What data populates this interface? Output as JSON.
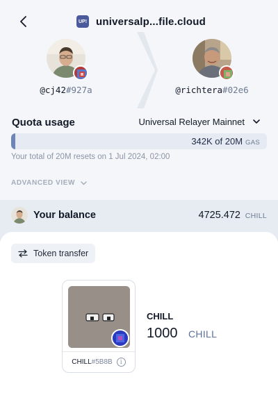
{
  "header": {
    "title": "universalp...file.cloud",
    "logo_text": "UP!",
    "back_icon": "chevron-left-icon"
  },
  "sender": {
    "handle": "@cj42",
    "hash": "#927a"
  },
  "receiver": {
    "handle": "@richtera",
    "hash": "#02e6"
  },
  "quota": {
    "title": "Quota usage",
    "network": "Universal Relayer Mainnet",
    "used_fraction": 0.017,
    "usage_text": "342K of 20M",
    "usage_unit": "GAS",
    "reset_note": "Your total of 20M resets on 1 Jul 2024, 02:00"
  },
  "advanced": {
    "label": "ADVANCED VIEW"
  },
  "balance": {
    "label": "Your balance",
    "amount": "4725.472",
    "unit": "CHILL"
  },
  "token_transfer": {
    "label": "Token transfer"
  },
  "nft": {
    "name": "CHILL",
    "hash": "#5B8B",
    "info_icon": "info-icon"
  },
  "token": {
    "name": "CHILL",
    "amount": "1000",
    "unit": "CHILL"
  },
  "colors": {
    "accent": "#6f86b5",
    "background": "#f4f6f9",
    "muted": "#8a94a6"
  }
}
